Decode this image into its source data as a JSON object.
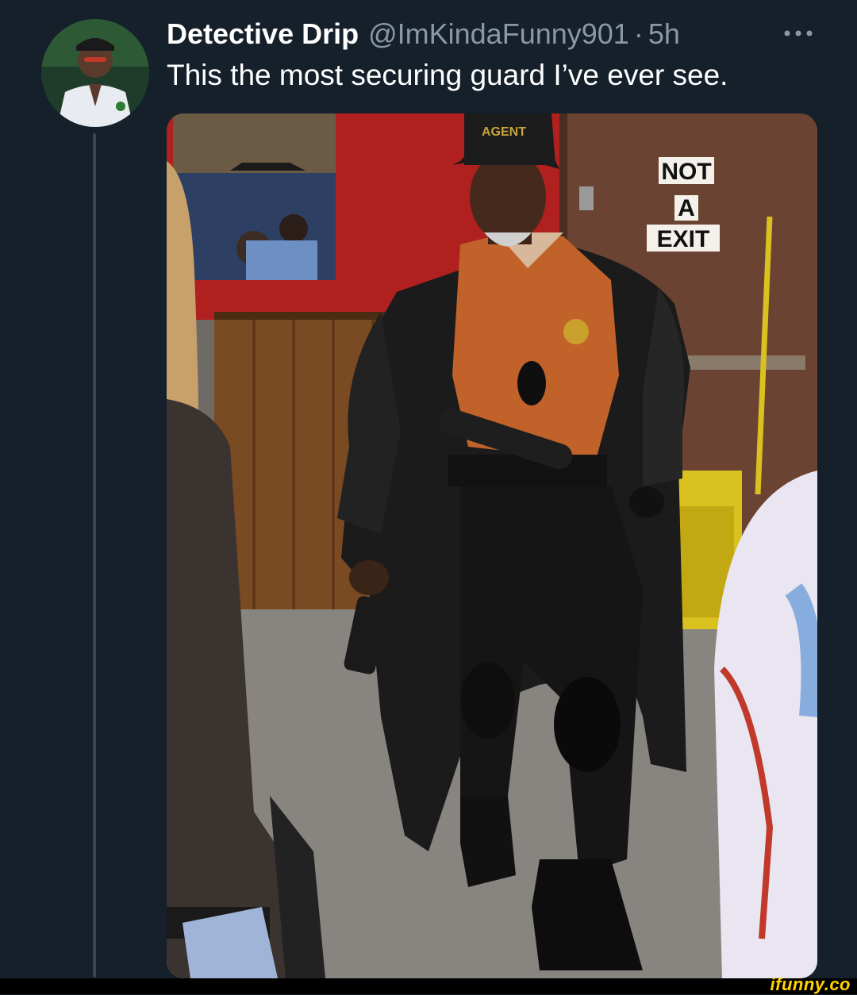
{
  "tweet": {
    "display_name": "Detective Drip",
    "handle": "@ImKindaFunny901",
    "separator": "·",
    "time_ago": "5h",
    "text": "This the most securing guard I’ve ever see.",
    "more_icon": "ellipsis-icon"
  },
  "media": {
    "sign_line1": "NOT",
    "sign_line2": "A",
    "sign_line3": "EXIT",
    "cap_text": "AGENT"
  },
  "watermark": "ifunny.co",
  "colors": {
    "background": "#15202b",
    "secondary_text": "#8b98a5",
    "watermark": "#ffd200"
  }
}
